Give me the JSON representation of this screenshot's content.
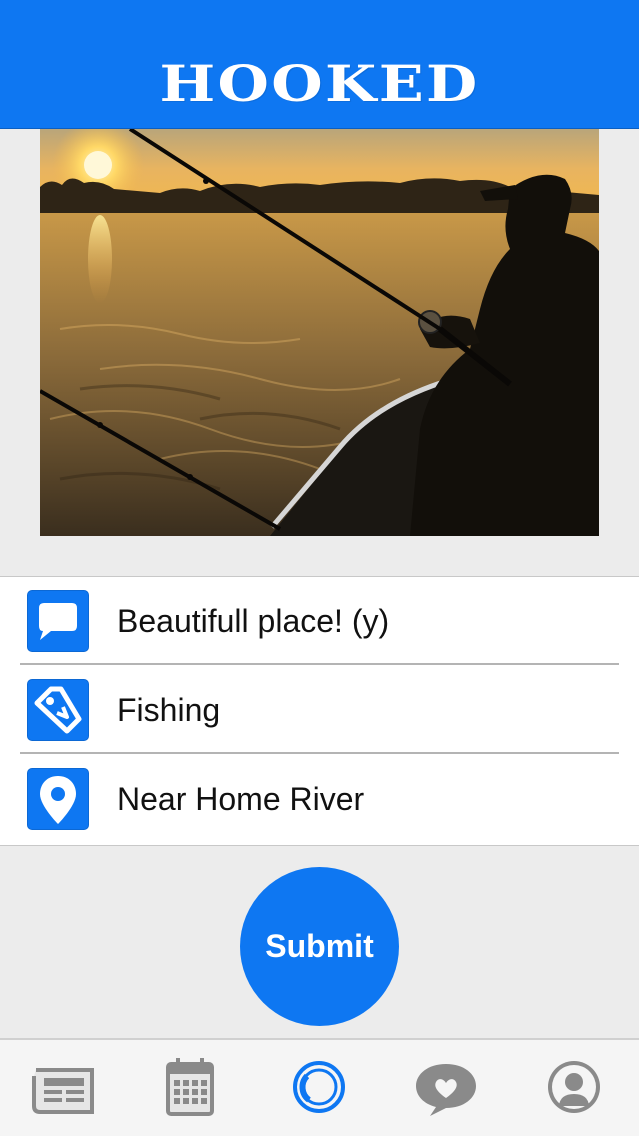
{
  "header": {
    "logo_text": "HOOKED"
  },
  "photo": {
    "subject": "photo"
  },
  "form": {
    "rows": [
      {
        "icon": "comment-icon",
        "value": "Beautifull place! (y)"
      },
      {
        "icon": "tag-icon",
        "value": "Fishing"
      },
      {
        "icon": "location-pin-icon",
        "value": "Near Home River"
      }
    ]
  },
  "submit": {
    "label": "Submit"
  },
  "tab_bar": {
    "tabs": [
      {
        "icon": "newspaper-icon"
      },
      {
        "icon": "calendar-icon"
      },
      {
        "icon": "camera-icon",
        "active": true
      },
      {
        "icon": "chat-heart-icon"
      },
      {
        "icon": "profile-icon"
      }
    ]
  },
  "colors": {
    "brand": "#0e77f2",
    "background": "#ececec",
    "tab_inactive": "#8a8a8a"
  }
}
